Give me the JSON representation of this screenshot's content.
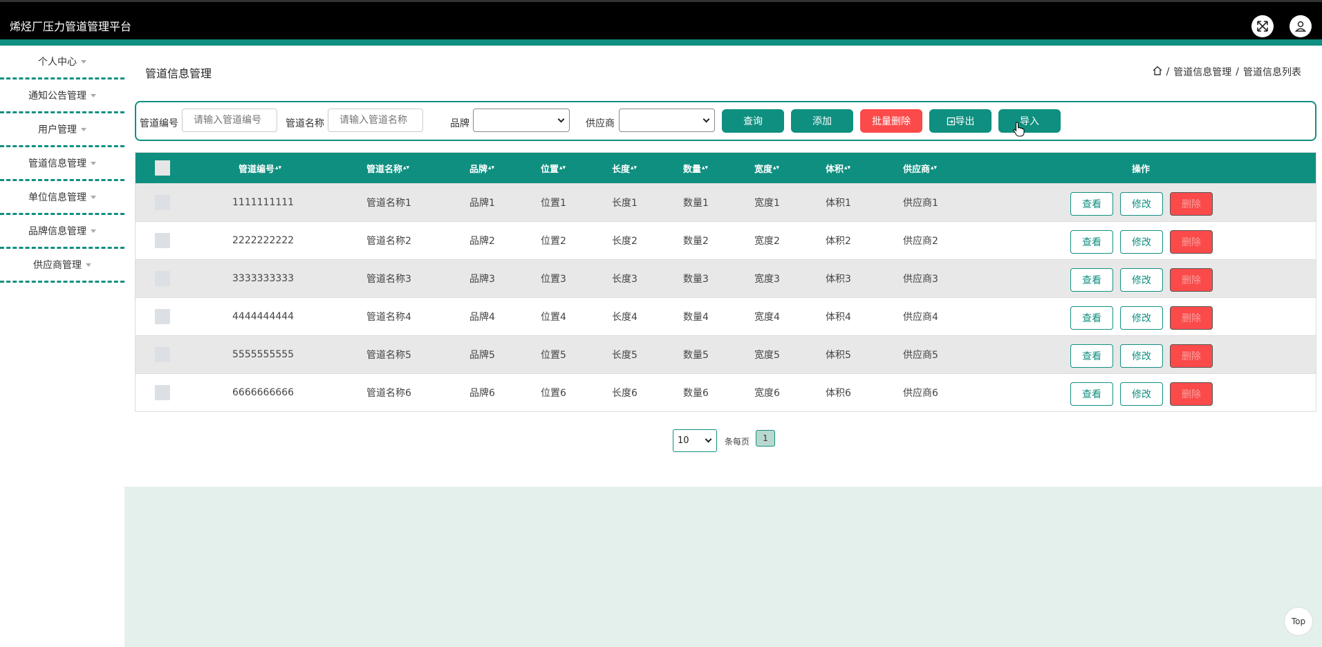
{
  "app": {
    "title": "烯烃厂压力管道管理平台"
  },
  "header": {
    "icons": [
      "fullscreen-icon",
      "user-icon"
    ]
  },
  "sidebar": {
    "items": [
      {
        "label": "个人中心"
      },
      {
        "label": "通知公告管理"
      },
      {
        "label": "用户管理"
      },
      {
        "label": "管道信息管理"
      },
      {
        "label": "单位信息管理"
      },
      {
        "label": "品牌信息管理"
      },
      {
        "label": "供应商管理"
      }
    ]
  },
  "page": {
    "title": "管道信息管理",
    "breadcrumb": [
      "管道信息管理",
      "管道信息列表"
    ]
  },
  "search": {
    "code_label": "管道编号",
    "code_placeholder": "请输入管道编号",
    "name_label": "管道名称",
    "name_placeholder": "请输入管道名称",
    "brand_label": "品牌",
    "brand_value": "",
    "supplier_label": "供应商",
    "supplier_value": "",
    "query_btn": "查询",
    "add_btn": "添加",
    "batch_delete_btn": "批量删除",
    "export_btn": "导出",
    "import_btn": "导入"
  },
  "table": {
    "columns": [
      "管道编号",
      "管道名称",
      "品牌",
      "位置",
      "长度",
      "数量",
      "宽度",
      "体积",
      "供应商",
      "操作"
    ],
    "rows": [
      {
        "code": "1111111111",
        "name": "管道名称1",
        "brand": "品牌1",
        "location": "位置1",
        "length": "长度1",
        "quantity": "数量1",
        "width": "宽度1",
        "volume": "体积1",
        "supplier": "供应商1"
      },
      {
        "code": "2222222222",
        "name": "管道名称2",
        "brand": "品牌2",
        "location": "位置2",
        "length": "长度2",
        "quantity": "数量2",
        "width": "宽度2",
        "volume": "体积2",
        "supplier": "供应商2"
      },
      {
        "code": "3333333333",
        "name": "管道名称3",
        "brand": "品牌3",
        "location": "位置3",
        "length": "长度3",
        "quantity": "数量3",
        "width": "宽度3",
        "volume": "体积3",
        "supplier": "供应商3"
      },
      {
        "code": "4444444444",
        "name": "管道名称4",
        "brand": "品牌4",
        "location": "位置4",
        "length": "长度4",
        "quantity": "数量4",
        "width": "宽度4",
        "volume": "体积4",
        "supplier": "供应商4"
      },
      {
        "code": "5555555555",
        "name": "管道名称5",
        "brand": "品牌5",
        "location": "位置5",
        "length": "长度5",
        "quantity": "数量5",
        "width": "宽度5",
        "volume": "体积5",
        "supplier": "供应商5"
      },
      {
        "code": "6666666666",
        "name": "管道名称6",
        "brand": "品牌6",
        "location": "位置6",
        "length": "长度6",
        "quantity": "数量6",
        "width": "宽度6",
        "volume": "体积6",
        "supplier": "供应商6"
      }
    ],
    "actions": {
      "view": "查看",
      "edit": "修改",
      "delete": "删除"
    }
  },
  "pagination": {
    "page_size": "10",
    "page_size_label": "条每页",
    "current_page": "1"
  },
  "back_to_top": "Top",
  "colors": {
    "accent": "#0f8f80",
    "danger": "#fb4a4a",
    "header_bg": "#000000",
    "footer_bg": "#e3f0ec"
  }
}
